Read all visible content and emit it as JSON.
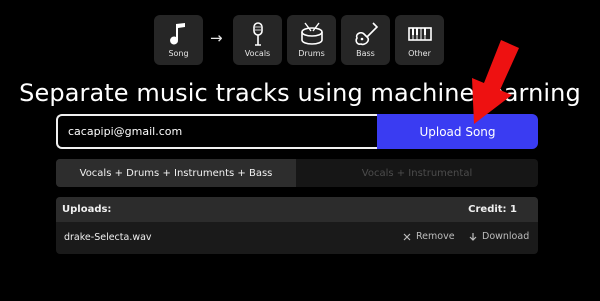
{
  "flow": {
    "source": {
      "label": "Song",
      "icon": "music-note-icon"
    },
    "arrow": "→",
    "outputs": [
      {
        "label": "Vocals",
        "icon": "microphone-icon"
      },
      {
        "label": "Drums",
        "icon": "drum-icon"
      },
      {
        "label": "Bass",
        "icon": "bass-guitar-icon"
      },
      {
        "label": "Other",
        "icon": "keyboard-icon"
      }
    ]
  },
  "heading": "Separate music tracks using machine learning",
  "form": {
    "email_value": "cacapipi@gmail.com",
    "upload_label": "Upload Song"
  },
  "modes": {
    "options": [
      "Vocals + Drums + Instruments + Bass",
      "Vocals + Instrumental"
    ],
    "selected": "Vocals + Drums + Instruments + Bass"
  },
  "uploads": {
    "title": "Uploads:",
    "credit": "Credit: 1",
    "files": [
      {
        "name": "drake-Selecta.wav",
        "remove_label": "Remove",
        "download_label": "Download"
      }
    ]
  },
  "colors": {
    "background": "#000000",
    "accent": "#3a3cf2",
    "annotation_arrow": "#ee1111"
  }
}
